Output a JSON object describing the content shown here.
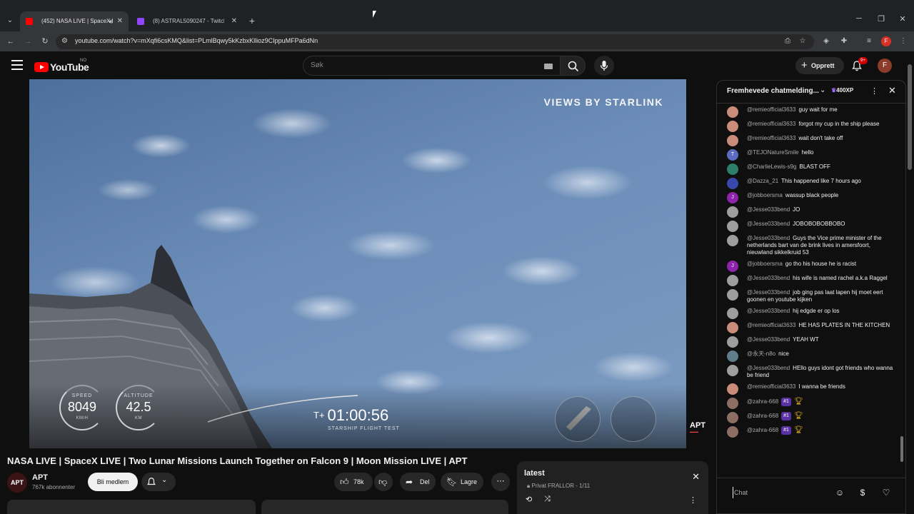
{
  "browser": {
    "tabs": [
      {
        "title": "(452) NASA LIVE | SpaceX LIVE",
        "active": true
      },
      {
        "title": "(8) ASTRAL5090247 - Twitch",
        "active": false
      }
    ],
    "url": "youtube.com/watch?v=mXqfi6csKMQ&list=PLmlBqwy5kKzbxKllioz9CIppuMFPa6dNn"
  },
  "header": {
    "logo_text": "YouTube",
    "logo_country": "NO",
    "search_placeholder": "Søk",
    "create_label": "Opprett",
    "notif_count": "9+",
    "avatar_letter": "F"
  },
  "video": {
    "overlay_brand": "VIEWS BY STARLINK",
    "speed_label": "SPEED",
    "speed_value": "8049",
    "speed_unit": "KM/H",
    "altitude_label": "ALTITUDE",
    "altitude_value": "42.5",
    "altitude_unit": "KM",
    "timer_prefix": "T+",
    "timer_value": "01:00:56",
    "timer_caption": "STARSHIP FLIGHT TEST",
    "corner_logo": "APT"
  },
  "meta": {
    "title": "NASA LIVE | SpaceX LIVE | Two Lunar Missions Launch Together on Falcon 9 | Moon Mission LIVE | APT",
    "channel_avatar": "APT",
    "channel_name": "APT",
    "subscribers": "767k abonnenter",
    "join_label": "Bli medlem",
    "likes": "78k",
    "share_label": "Del",
    "save_label": "Lagre"
  },
  "playlist": {
    "title": "latest",
    "meta": "Privat FRALLOR - 1/11"
  },
  "chat": {
    "title": "Fremhevede chatmelding...",
    "xp": "400XP",
    "input_placeholder": "Chat",
    "messages": [
      {
        "author": "@remieofficial3633",
        "text": "guy wait for me",
        "color": "#c98b7a",
        "initial": ""
      },
      {
        "author": "@remieofficial3633",
        "text": "forgot my cup in the ship please",
        "color": "#c98b7a",
        "initial": ""
      },
      {
        "author": "@remieofficial3633",
        "text": "wait don't take off",
        "color": "#c98b7a",
        "initial": ""
      },
      {
        "author": "@TEJONatureSmile",
        "text": "hello",
        "color": "#5c6bc0",
        "initial": "T"
      },
      {
        "author": "@CharlieLewis-s9g",
        "text": "BLAST OFF",
        "color": "#2e7d6b",
        "initial": ""
      },
      {
        "author": "@Dazza_21",
        "text": "This happened like 7 hours ago",
        "color": "#3949ab",
        "initial": ""
      },
      {
        "author": "@jobboersma",
        "text": "wassup black people",
        "color": "#8e24aa",
        "initial": "J"
      },
      {
        "author": "@Jesse033bend",
        "text": "JO",
        "color": "#9e9e9e",
        "initial": ""
      },
      {
        "author": "@Jesse033bend",
        "text": "JOBOBOBOBBOBO",
        "color": "#9e9e9e",
        "initial": ""
      },
      {
        "author": "@Jesse033bend",
        "text": "Guys the Vice prime minister of the netherlands bart van de brink lives in amersfoort, nieuwland sikkelkruid 53",
        "color": "#9e9e9e",
        "initial": ""
      },
      {
        "author": "@jobboersma",
        "text": "go tho his house he is racist",
        "color": "#8e24aa",
        "initial": "J"
      },
      {
        "author": "@Jesse033bend",
        "text": "his wife is named rachel a.k.a Raggel",
        "color": "#9e9e9e",
        "initial": ""
      },
      {
        "author": "@Jesse033bend",
        "text": "job ging pas laat lapen hij moet eert goonen en youtube kijken",
        "color": "#9e9e9e",
        "initial": ""
      },
      {
        "author": "@Jesse033bend",
        "text": "hij edgde er op los",
        "color": "#9e9e9e",
        "initial": ""
      },
      {
        "author": "@remieofficial3633",
        "text": "HE HAS PLATES IN THE KITCHEN",
        "color": "#c98b7a",
        "initial": ""
      },
      {
        "author": "@Jesse033bend",
        "text": "YEAH WT",
        "color": "#9e9e9e",
        "initial": ""
      },
      {
        "author": "@永天-n8o",
        "text": "nice",
        "color": "#607d8b",
        "initial": ""
      },
      {
        "author": "@Jesse033bend",
        "text": "HEllo guys idont got friends who wanna be friend",
        "color": "#9e9e9e",
        "initial": ""
      },
      {
        "author": "@remieofficial3633",
        "text": "I wanna be friends",
        "color": "#c98b7a",
        "initial": ""
      },
      {
        "author": "@zahra-668",
        "text": "",
        "color": "#8d6e63",
        "initial": "",
        "badge": "#1"
      },
      {
        "author": "@zahra-668",
        "text": "",
        "color": "#8d6e63",
        "initial": "",
        "badge": "#1"
      },
      {
        "author": "@zahra-668",
        "text": "",
        "color": "#8d6e63",
        "initial": "",
        "badge": "#1"
      }
    ]
  }
}
